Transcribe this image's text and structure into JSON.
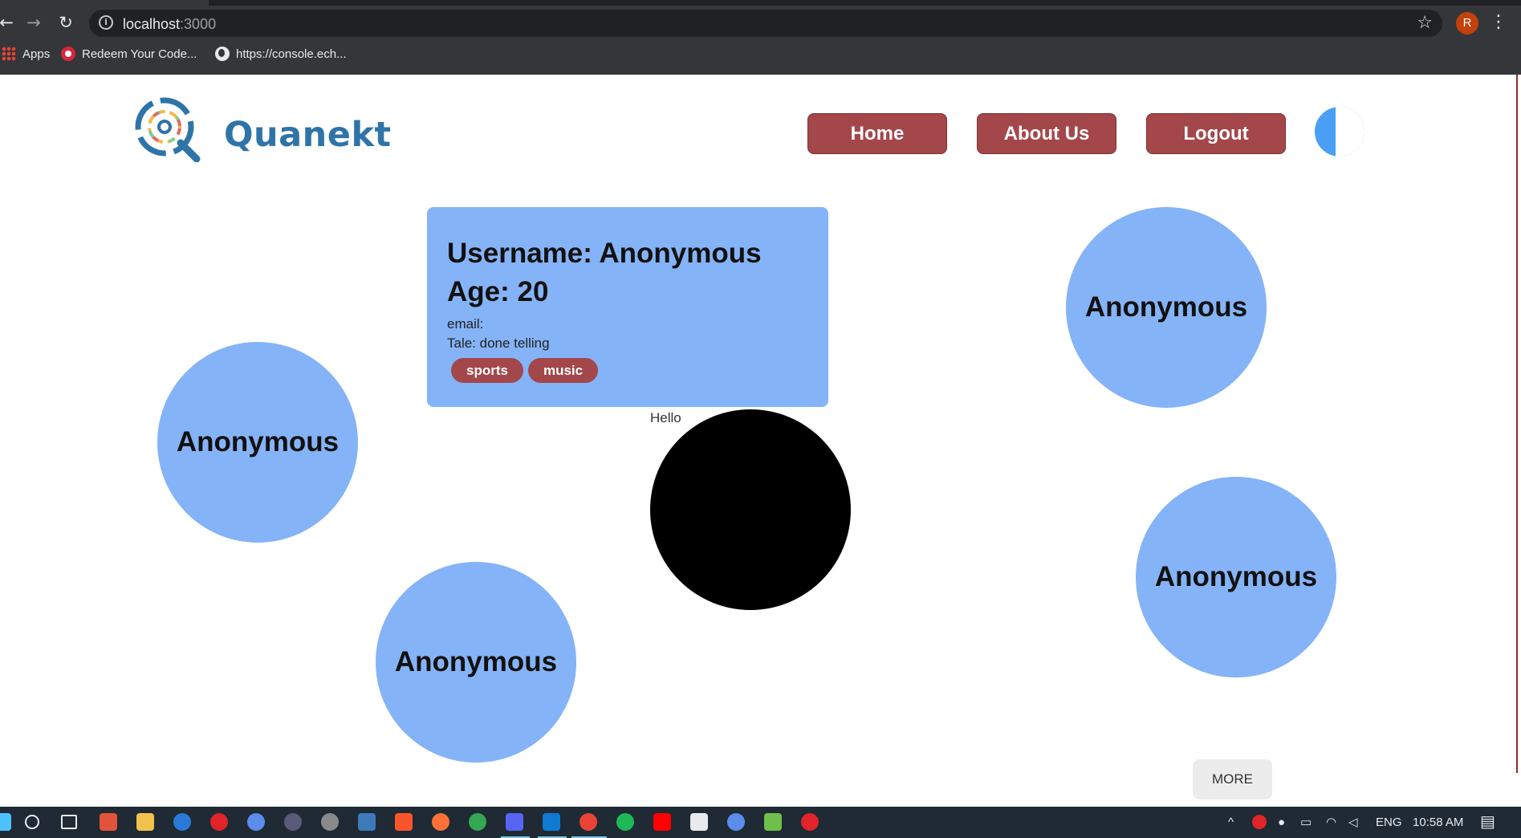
{
  "browser": {
    "url_host": "localhost",
    "url_port": ":3000",
    "profile_initial": "R",
    "bookmarks": [
      {
        "label": "Apps",
        "icon": "apps-grid-icon"
      },
      {
        "label": "Redeem Your Code...",
        "icon": "redeem-icon"
      },
      {
        "label": "https://console.ech...",
        "icon": "globe-icon"
      }
    ]
  },
  "header": {
    "brand": "Quanekt",
    "nav": [
      {
        "label": "Home"
      },
      {
        "label": "About Us"
      },
      {
        "label": "Logout"
      }
    ]
  },
  "profile_card": {
    "username_line": "Username: Anonymous",
    "age_line": "Age: 20",
    "email_line": "email:",
    "tale_line": "Tale: done telling",
    "tags": [
      "sports",
      "music"
    ]
  },
  "hello_label": "Hello",
  "users": [
    {
      "name": "Anonymous"
    },
    {
      "name": "Anonymous"
    },
    {
      "name": "Anonymous"
    },
    {
      "name": "Anonymous"
    }
  ],
  "more_label": "MORE",
  "taskbar": {
    "language": "ENG",
    "time": "10:58 AM"
  },
  "colors": {
    "brand_blue": "#2e74a8",
    "nav_maroon": "#a3474b",
    "bubble_blue": "#85b3f7"
  }
}
